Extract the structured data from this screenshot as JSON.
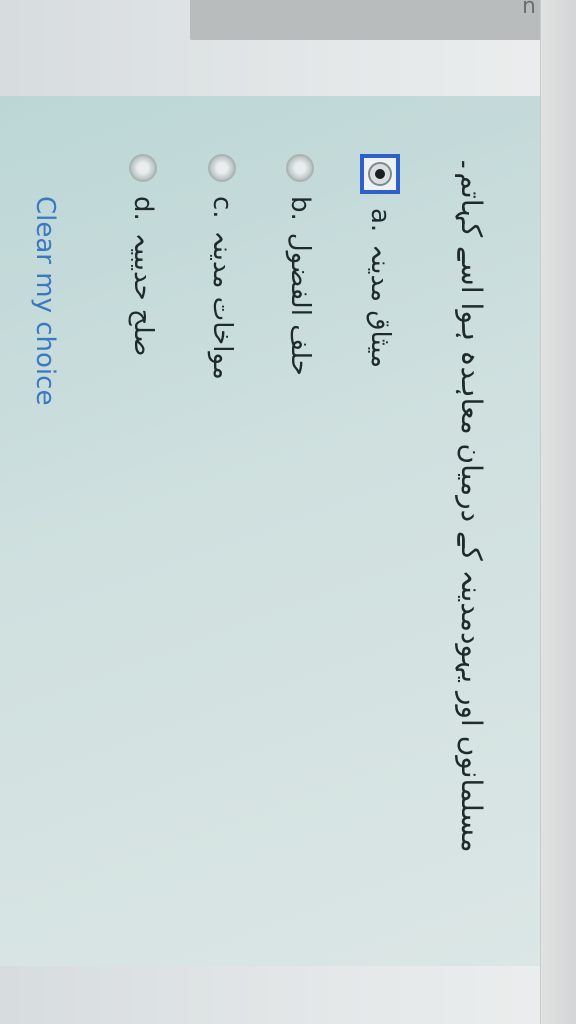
{
  "top_bar": {
    "glyph": "n"
  },
  "question": {
    "text": "مسلمانوں اور یہودمدینہ کے درمیان معاہدہ ہوا اسے کہاتم۔"
  },
  "options": [
    {
      "letter": "a.",
      "text": "میثاق مدینہ",
      "selected": true
    },
    {
      "letter": "b.",
      "text": "حلف الفضول",
      "selected": false
    },
    {
      "letter": "c.",
      "text": "مواخات مدینہ",
      "selected": false
    },
    {
      "letter": "d.",
      "text": "صلح حدیبیہ",
      "selected": false
    }
  ],
  "clear_label": "Clear my choice",
  "colors": {
    "selected_border": "#2f5fc8",
    "link": "#3b78c2"
  }
}
